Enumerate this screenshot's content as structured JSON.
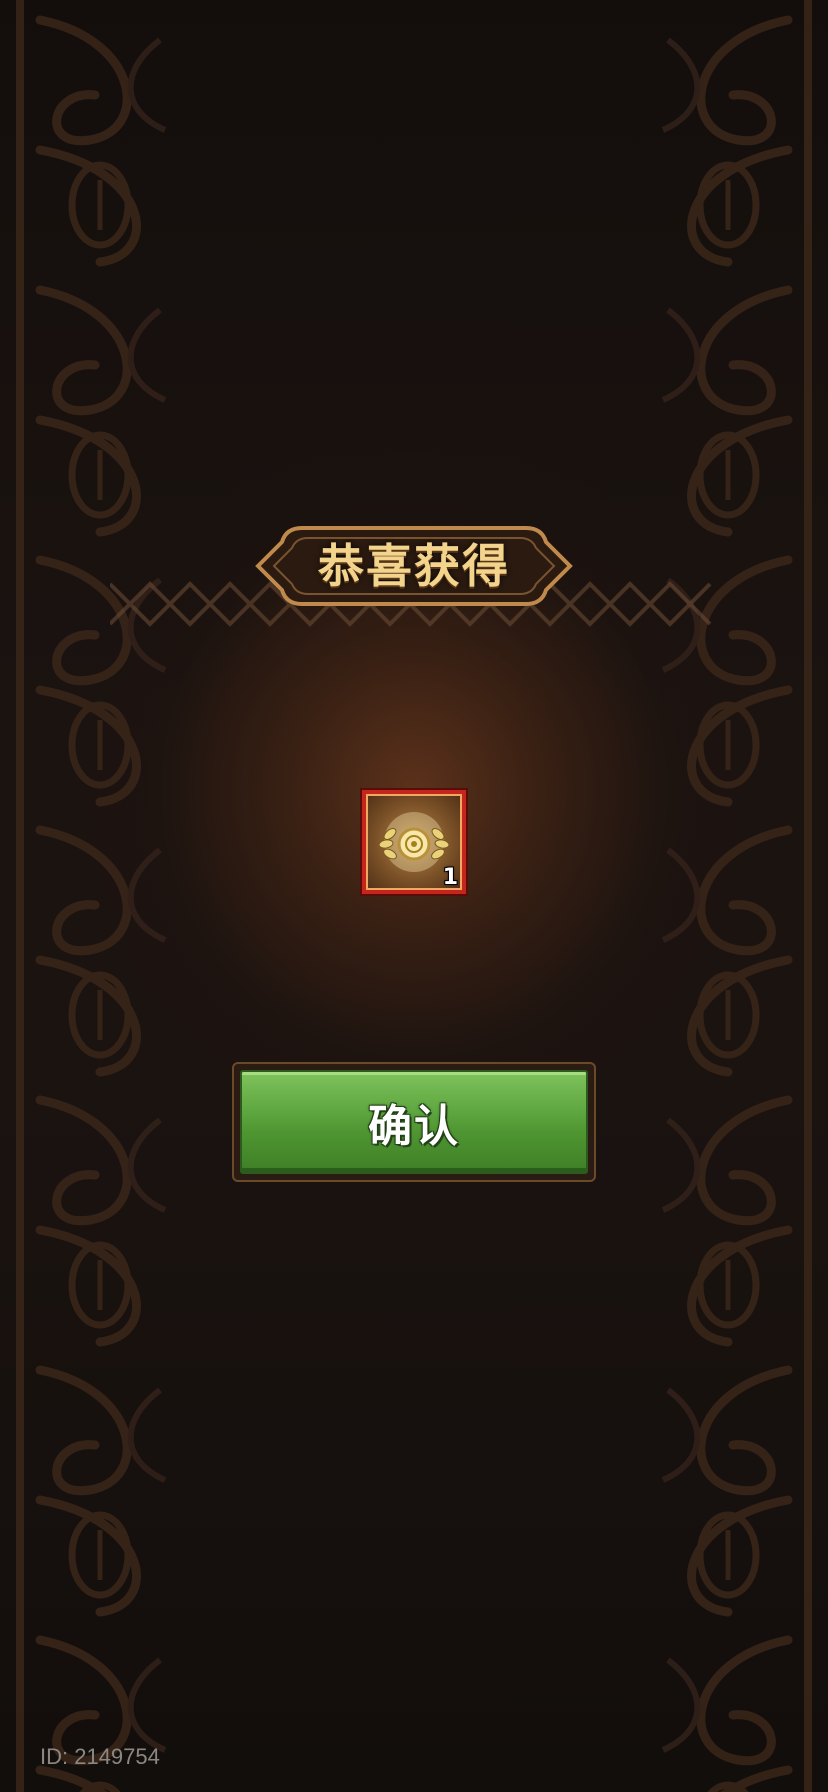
{
  "title": "恭喜获得",
  "reward": {
    "icon": "golden-laurel-coin-icon",
    "count": "1"
  },
  "confirm_label": "确认",
  "player_id": "ID: 2149754",
  "colors": {
    "title_gold": "#f3d48c",
    "button_green": "#62aa43",
    "item_border_red": "#c2261d",
    "background_dark": "#140f0d"
  }
}
